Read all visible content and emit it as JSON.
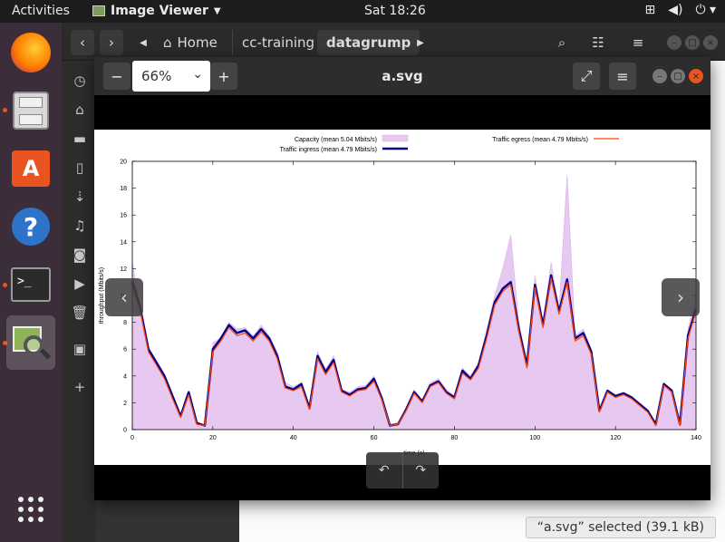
{
  "topbar": {
    "activities": "Activities",
    "app_name": "Image Viewer",
    "clock": "Sat 18:26"
  },
  "files": {
    "breadcrumbs": [
      "Home",
      "cc-training",
      "datagrump"
    ],
    "status": "“a.svg” selected  (39.1 kB)"
  },
  "viewer": {
    "zoom": "66%",
    "title": "a.svg"
  },
  "colors": {
    "capacity_fill": "#e6c8f0",
    "ingress": "#00008b",
    "egress": "#ff4500",
    "dock_bg": "#3b2e3a",
    "accent": "#e95420"
  },
  "chart_data": {
    "type": "line",
    "xlabel": "time (s)",
    "ylabel": "throughput (Mbits/s)",
    "xlim": [
      0,
      140
    ],
    "ylim": [
      0,
      20
    ],
    "x_ticks": [
      0,
      20,
      40,
      60,
      80,
      100,
      120,
      140
    ],
    "y_ticks": [
      0,
      2,
      4,
      6,
      8,
      10,
      12,
      14,
      16,
      18,
      20
    ],
    "legend_placement": "top",
    "grid": false,
    "legend": [
      "Capacity (mean 5.04 Mbits/s)",
      "Traffic egress (mean 4.79 Mbits/s)",
      "Traffic ingress (mean 4.79 Mbits/s)"
    ],
    "x": [
      0,
      2,
      4,
      6,
      8,
      10,
      12,
      14,
      16,
      18,
      20,
      22,
      24,
      26,
      28,
      30,
      32,
      34,
      36,
      38,
      40,
      42,
      44,
      46,
      48,
      50,
      52,
      54,
      56,
      58,
      60,
      62,
      64,
      66,
      68,
      70,
      72,
      74,
      76,
      78,
      80,
      82,
      84,
      86,
      88,
      90,
      92,
      94,
      96,
      98,
      100,
      102,
      104,
      106,
      108,
      110,
      112,
      114,
      116,
      118,
      120,
      122,
      124,
      126,
      128,
      130,
      132,
      134,
      136,
      138,
      140
    ],
    "series": [
      {
        "name": "Capacity",
        "type": "area",
        "values": [
          12.5,
          9,
          6,
          5,
          4,
          2.5,
          1,
          2.8,
          0.5,
          0.3,
          6.5,
          6.8,
          8,
          7.5,
          7.6,
          7,
          7.8,
          7,
          5.8,
          3.5,
          3.2,
          3.5,
          1.8,
          5.8,
          4.5,
          5.5,
          3,
          2.8,
          3.2,
          3.3,
          4,
          2.5,
          0.4,
          0.5,
          1.5,
          3,
          2.2,
          3.5,
          3.8,
          3,
          2.5,
          4.6,
          4,
          5,
          7.5,
          10,
          12,
          14.5,
          8,
          5,
          11.5,
          8,
          12.5,
          9,
          19,
          7,
          7.5,
          6,
          1.5,
          3,
          2.6,
          2.8,
          2.5,
          2,
          1.5,
          0.5,
          3.5,
          3,
          0.5,
          7.5,
          10
        ]
      },
      {
        "name": "Traffic ingress",
        "values": [
          11,
          9,
          6,
          5,
          4,
          2.5,
          1,
          2.8,
          0.5,
          0.3,
          6,
          6.8,
          7.8,
          7.2,
          7.4,
          6.8,
          7.5,
          6.8,
          5.5,
          3.2,
          3,
          3.4,
          1.6,
          5.5,
          4.3,
          5.2,
          2.9,
          2.6,
          3,
          3.1,
          3.8,
          2.3,
          0.3,
          0.4,
          1.5,
          2.8,
          2.1,
          3.3,
          3.6,
          2.8,
          2.4,
          4.4,
          3.8,
          4.8,
          7,
          9.5,
          10.5,
          11,
          7.5,
          4.8,
          10.8,
          7.8,
          11.5,
          8.8,
          11.2,
          6.8,
          7.2,
          5.8,
          1.4,
          2.9,
          2.5,
          2.7,
          2.4,
          1.9,
          1.4,
          0.4,
          3.4,
          2.9,
          0.4,
          7,
          9
        ]
      },
      {
        "name": "Traffic egress",
        "values": [
          10.8,
          8.8,
          5.8,
          4.8,
          3.8,
          2.3,
          0.9,
          2.6,
          0.4,
          0.3,
          5.8,
          6.6,
          7.6,
          7,
          7.2,
          6.6,
          7.3,
          6.6,
          5.3,
          3.1,
          2.9,
          3.2,
          1.5,
          5.3,
          4.1,
          5,
          2.8,
          2.5,
          2.9,
          3,
          3.6,
          2.2,
          0.3,
          0.4,
          1.4,
          2.7,
          2,
          3.2,
          3.5,
          2.7,
          2.3,
          4.2,
          3.7,
          4.6,
          6.8,
          9.3,
          10.3,
          10.8,
          7.3,
          4.6,
          10.6,
          7.6,
          11.3,
          8.6,
          11,
          6.6,
          7,
          5.6,
          1.3,
          2.8,
          2.4,
          2.6,
          2.3,
          1.8,
          1.3,
          0.3,
          3.3,
          2.8,
          0.3,
          6.8,
          8.8
        ]
      }
    ]
  }
}
